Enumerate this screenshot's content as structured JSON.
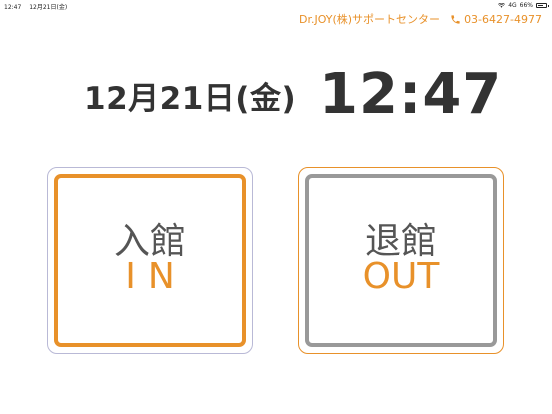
{
  "status_bar": {
    "time": "12:47",
    "date": "12月21日(金)",
    "network": "4G",
    "battery": "66%",
    "battery_level": 0.66
  },
  "support": {
    "name": "Dr.JOY(株)サポートセンター",
    "phone": "03-6427-4977",
    "color": "#e8912a"
  },
  "clock": {
    "date": "12月21日(金)",
    "time": "12:47"
  },
  "buttons": {
    "in": {
      "label": "入館",
      "sub": "IN"
    },
    "out": {
      "label": "退館",
      "sub": "OUT"
    }
  },
  "colors": {
    "accent": "#e8912a",
    "text": "#333333",
    "out_border": "#999999"
  }
}
